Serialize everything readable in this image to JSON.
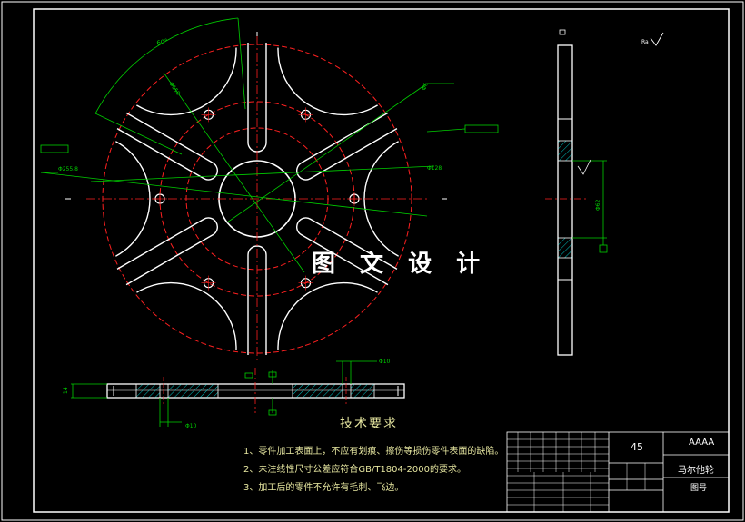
{
  "drawing": {
    "watermark": "图 文 设 计",
    "title": "马尔他轮",
    "material": "45",
    "code": "AAAA",
    "drawing_no_label": "图号"
  },
  "technical_requirements": {
    "heading": "技术要求",
    "items": [
      "1、零件加工表面上，不应有划痕、擦伤等损伤零件表面的缺陷。",
      "2、未注线性尺寸公差应符合GB/T1804-2000的要求。",
      "3、加工后的零件不允许有毛刺、飞边。"
    ]
  },
  "dimensions": {
    "angle": "60°",
    "dia_left": "Φ255.8",
    "dia_right": "Φ128",
    "dia_side": "Φ62",
    "dia_bottom_right": "Φ10",
    "dia_bottom_left": "Φ10",
    "thickness": "14",
    "dia_top": "Φ6",
    "dim_diag": "Φ150",
    "roughness": "Ra"
  },
  "colors": {
    "background": "#000000",
    "line": "#ffffff",
    "center": "#ff2020",
    "dimension": "#00d000",
    "hatch": "#00c0c0",
    "note_text": "#e6e6a0"
  }
}
